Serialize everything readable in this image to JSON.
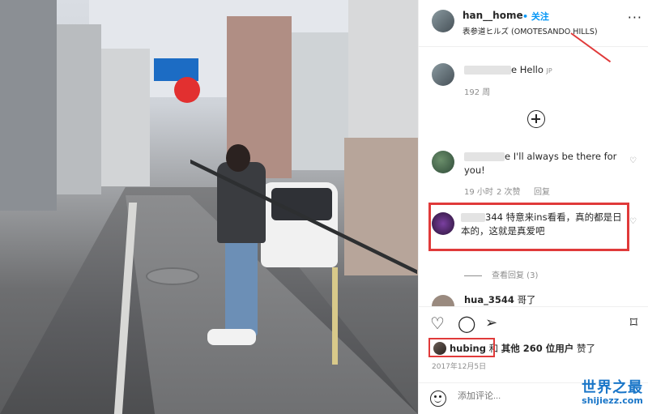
{
  "post": {
    "username": "han__home",
    "follow_label": "• 关注",
    "location": "表参道ヒルズ (OMOTESANDO HILLS)",
    "more_label": "···"
  },
  "comments": [
    {
      "text_visible": "e Hello",
      "lang_badge": "JP",
      "time": "192 周"
    },
    {
      "text_visible": "e I'll always be there for you!",
      "time": "19 小时",
      "likes": "2 次赞",
      "reply": "回复"
    },
    {
      "text_visible": "344 特意来ins看看，真的都是日本的，这就是真爱吧"
    },
    {
      "username_visible": "hua_3544",
      "text": "哥了"
    }
  ],
  "view_replies": "查看回复 (3)",
  "likes": {
    "user": "hubing",
    "connector": "和",
    "others": "其他 260 位用户",
    "suffix": "赞了"
  },
  "date": "2017年12月5日",
  "add_comment_placeholder": "添加评论...",
  "watermark": {
    "cn": "世界之最",
    "en": "shijiezz.com"
  },
  "colors": {
    "highlight": "#e03a3a",
    "link": "#0095f6",
    "watermark": "#1a76c8"
  }
}
